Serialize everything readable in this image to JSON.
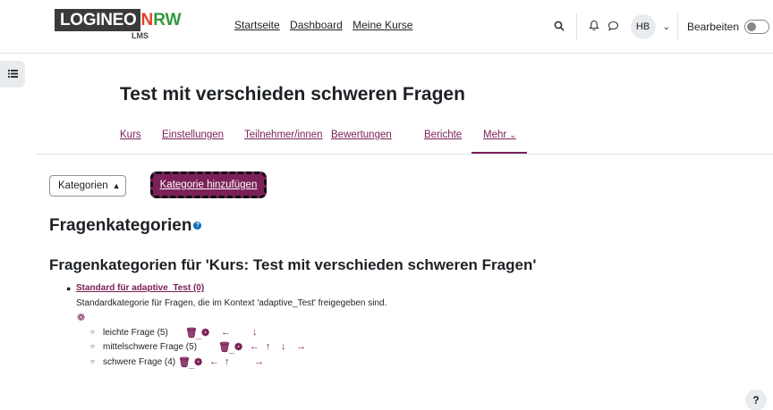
{
  "brand": {
    "logo_main": "LOGINEO",
    "logo_n": "N",
    "logo_rw": "RW",
    "logo_sub": "LMS"
  },
  "primary_nav": [
    "Startseite",
    "Dashboard",
    "Meine Kurse"
  ],
  "user": {
    "initials": "HB",
    "edit_label": "Bearbeiten"
  },
  "icons": {
    "search": "search-icon",
    "bell": "bell-icon",
    "chat": "chat-icon"
  },
  "page": {
    "title": "Test mit verschieden schweren Fragen"
  },
  "secondary_nav": [
    "Kurs",
    "Einstellungen",
    "Teilnehmer/innen",
    "Bewertungen",
    "Berichte",
    "Mehr"
  ],
  "toolbar": {
    "select_value": "Kategorien",
    "add_button": "Kategorie hinzufügen"
  },
  "headings": {
    "main": "Fragenkategorien",
    "sub": "Fragenkategorien für 'Kurs: Test mit verschieden schweren Fragen'"
  },
  "categories": {
    "root_label": "Standard für adaptive_Test (0)",
    "root_desc": "Standardkategorie für Fragen, die im Kontext 'adaptive_Test' freigegeben sind.",
    "children": [
      {
        "label": "leichte Frage (5)"
      },
      {
        "label": "mittelschwere Frage (5)"
      },
      {
        "label": "schwere Frage (4)"
      }
    ]
  },
  "help_float": "?",
  "colors": {
    "accent": "#7b2058",
    "help": "#0f6cbf"
  }
}
